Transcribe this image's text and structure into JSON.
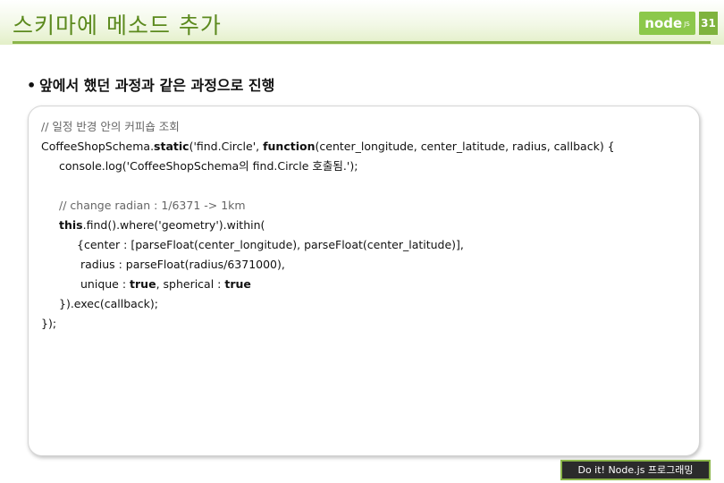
{
  "slide": {
    "title": "스키마에 메소드 추가",
    "page_number": "31",
    "logo_text": "node",
    "logo_suffix": "JS"
  },
  "bullet": {
    "symbol": "•",
    "text": "앞에서 했던 과정과 같은 과정으로 진행"
  },
  "code": {
    "line1": "// 일정 반경 안의 커피숍 조회",
    "line2_a": "CoffeeShopSchema.",
    "line2_kw1": "static",
    "line2_b": "('find.Circle', ",
    "line2_kw2": "function",
    "line2_c": "(center_longitude, center_latitude, radius, callback) {",
    "line3": "console.log('CoffeeShopSchema의 find.Circle 호출됨.');",
    "line4": "// change radian : 1/6371 -> 1km",
    "line5_kw": "this",
    "line5_rest": ".find().where('geometry').within(",
    "line6": "{center : [parseFloat(center_longitude), parseFloat(center_latitude)],",
    "line7": "radius : parseFloat(radius/6371000),",
    "line8_a": "unique : ",
    "line8_kw1": "true",
    "line8_b": ", spherical : ",
    "line8_kw2": "true",
    "line9": "}).exec(callback);",
    "line10": "});"
  },
  "footer": {
    "label": "Do it! Node.js 프로그래밍"
  }
}
